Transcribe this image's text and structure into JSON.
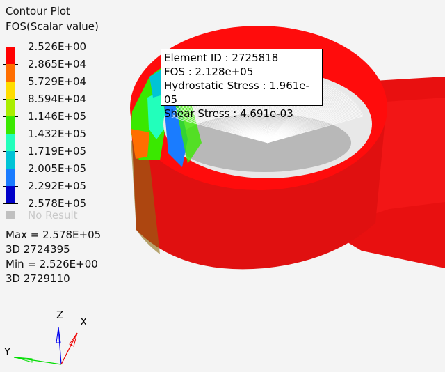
{
  "legend": {
    "title": "Contour Plot",
    "subtitle": "FOS(Scalar value)",
    "levels": [
      "2.526E+00",
      "2.865E+04",
      "5.729E+04",
      "8.594E+04",
      "1.146E+05",
      "1.432E+05",
      "1.719E+05",
      "2.005E+05",
      "2.292E+05",
      "2.578E+05"
    ],
    "colors": [
      "#ff0000",
      "#ff6e00",
      "#ffdd00",
      "#aaee00",
      "#3ae800",
      "#22ffbb",
      "#00c4d6",
      "#1a7cff",
      "#0000c8"
    ],
    "no_result": "No Result",
    "no_result_color": "#c0c0c0",
    "max_label": "Max =  2.578E+05",
    "max_elem": "3D 2724395",
    "min_label": "Min =  2.526E+00",
    "min_elem": "3D 2729110"
  },
  "tooltip": {
    "element_id": "Element ID : 2725818",
    "fos": "FOS : 2.128e+05",
    "hydrostatic": "Hydrostatic Stress : 1.961e-05",
    "shear": "Shear Stress : 4.691e-03"
  },
  "triad": {
    "x": "X",
    "y": "Y",
    "z": "Z"
  }
}
